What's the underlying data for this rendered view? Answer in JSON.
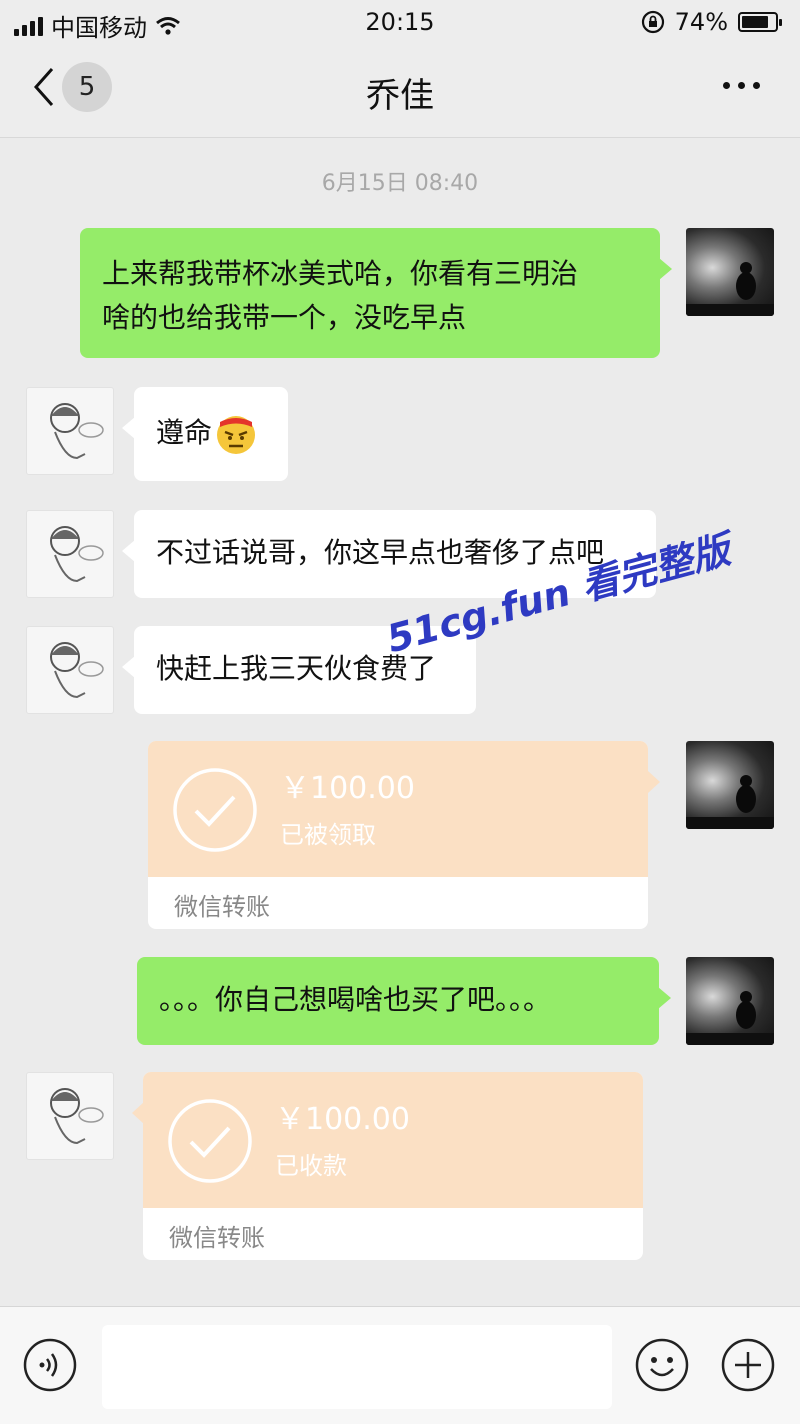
{
  "status_bar": {
    "carrier": "中国移动",
    "time": "20:15",
    "battery": "74%",
    "battery_level": 0.74
  },
  "nav": {
    "back_count": "5",
    "title": "乔佳"
  },
  "chat": {
    "timestamp": "6月15日 08:40",
    "msg1": {
      "line1": "上来帮我带杯冰美式哈，你看有三明治",
      "line2": "啥的也给我带一个，没吃早点"
    },
    "msg2": {
      "text": "遵命",
      "emoji": "angry-face-emoji"
    },
    "msg3": {
      "text": "不过话说哥，你这早点也奢侈了点吧"
    },
    "msg4": {
      "text": "快赶上我三天伙食费了"
    },
    "transfer1": {
      "amount": "￥100.00",
      "status": "已被领取",
      "label": "微信转账"
    },
    "msg5": {
      "text": "。。。你自己想喝啥也买了吧。。。"
    },
    "transfer2": {
      "amount": "￥100.00",
      "status": "已收款",
      "label": "微信转账"
    }
  },
  "watermark": "51cg.fun 看完整版",
  "colors": {
    "sent_bubble": "#95ec69",
    "received_bubble": "#ffffff",
    "transfer": "#fbe0c4",
    "background": "#ebebeb"
  }
}
